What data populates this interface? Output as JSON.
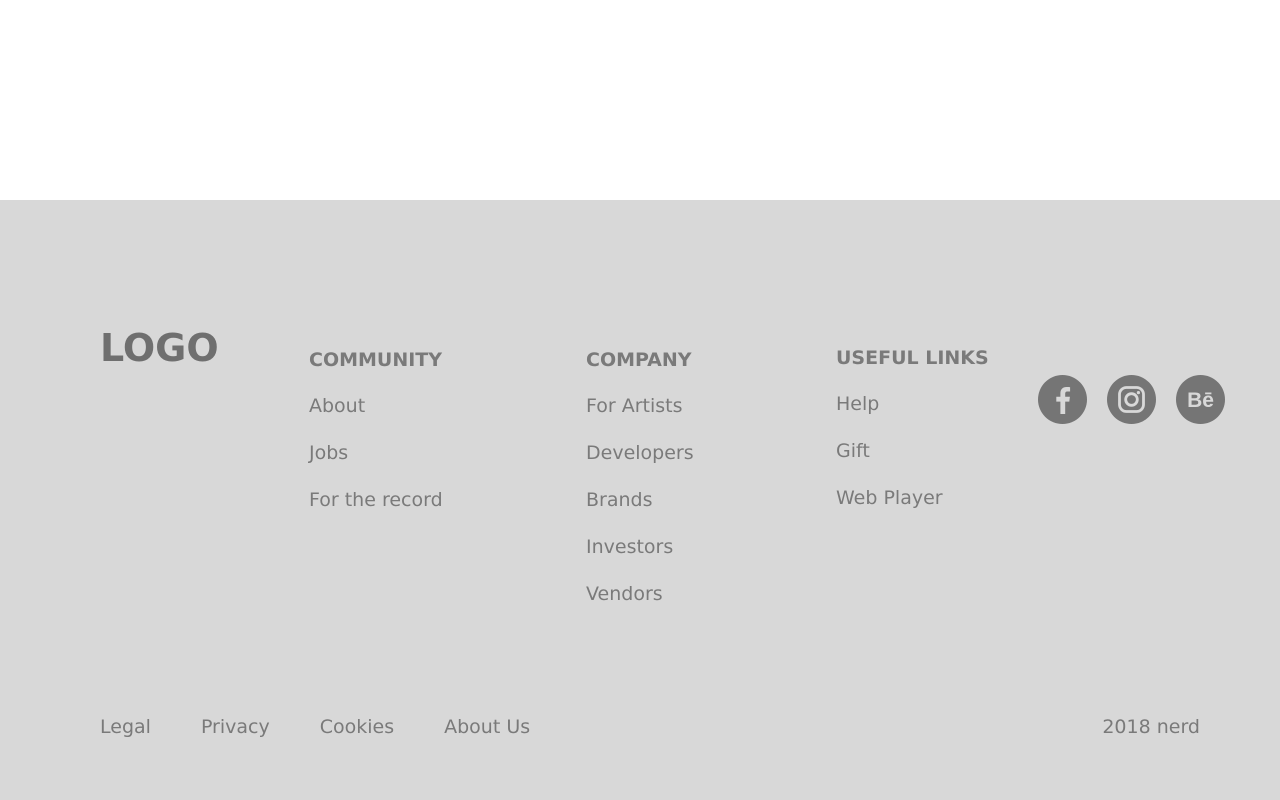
{
  "logo": {
    "text": "LOGO"
  },
  "columns": {
    "community": {
      "heading": "COMMUNITY",
      "items": [
        "About",
        "Jobs",
        "For the record"
      ]
    },
    "company": {
      "heading": "COMPANY",
      "items": [
        "For Artists",
        "Developers",
        "Brands",
        "Investors",
        "Vendors"
      ]
    },
    "useful_links": {
      "heading": "USEFUL LINKS",
      "items": [
        "Help",
        "Gift",
        "Web Player"
      ]
    }
  },
  "social": {
    "icons": [
      "facebook-icon",
      "instagram-icon",
      "behance-icon"
    ],
    "behance_text": "Bē"
  },
  "bottom": {
    "links": [
      "Legal",
      "Privacy",
      "Cookies",
      "About Us"
    ],
    "copyright": "2018 nerd"
  },
  "colors": {
    "footer_bg": "#d8d8d8",
    "text": "#7a7a7a",
    "icon_bg": "#757575",
    "top_bg": "#ffffff"
  }
}
